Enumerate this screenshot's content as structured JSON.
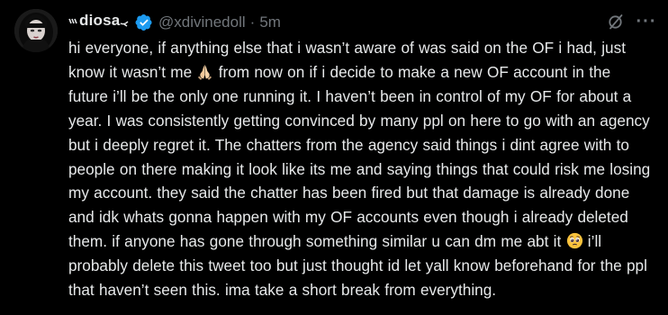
{
  "author": {
    "display_name": "diosa",
    "handle": "@xdivinedoll",
    "separator": "·",
    "time": "5m"
  },
  "icons": {
    "avatar": "profile-photo",
    "verified": "verified-badge-icon",
    "grok": "grok-icon",
    "more": "more-icon"
  },
  "more_label": "···",
  "tweet": {
    "part1": "hi everyone, if anything else that i wasn’t aware of was said on the OF i had, just know it wasn’t me ",
    "emoji1": "🙏🏼",
    "part2": " from now on if i decide to make a new OF account in the future i’ll be the only one running it. I haven’t been in control of my OF for about a year. I was consistently getting convinced by many ppl on here to go with an agency but i deeply regret it. The chatters from the agency said things i dint agree with to people on there making it look like its me and saying things that could risk me losing my account. they said the chatter has been fired but that damage is already done and idk whats gonna happen with my OF accounts even though i already deleted them. if anyone has gone through something similar u can dm me abt it ",
    "emoji2": "🥺",
    "part3": " i’ll probably delete this tweet too but just thought id let yall know beforehand for the ppl that haven’t seen this. ima take a short break from everything."
  },
  "colors": {
    "background": "#000000",
    "text": "#e7e9ea",
    "secondary": "#71767b",
    "verified": "#1d9bf0"
  }
}
